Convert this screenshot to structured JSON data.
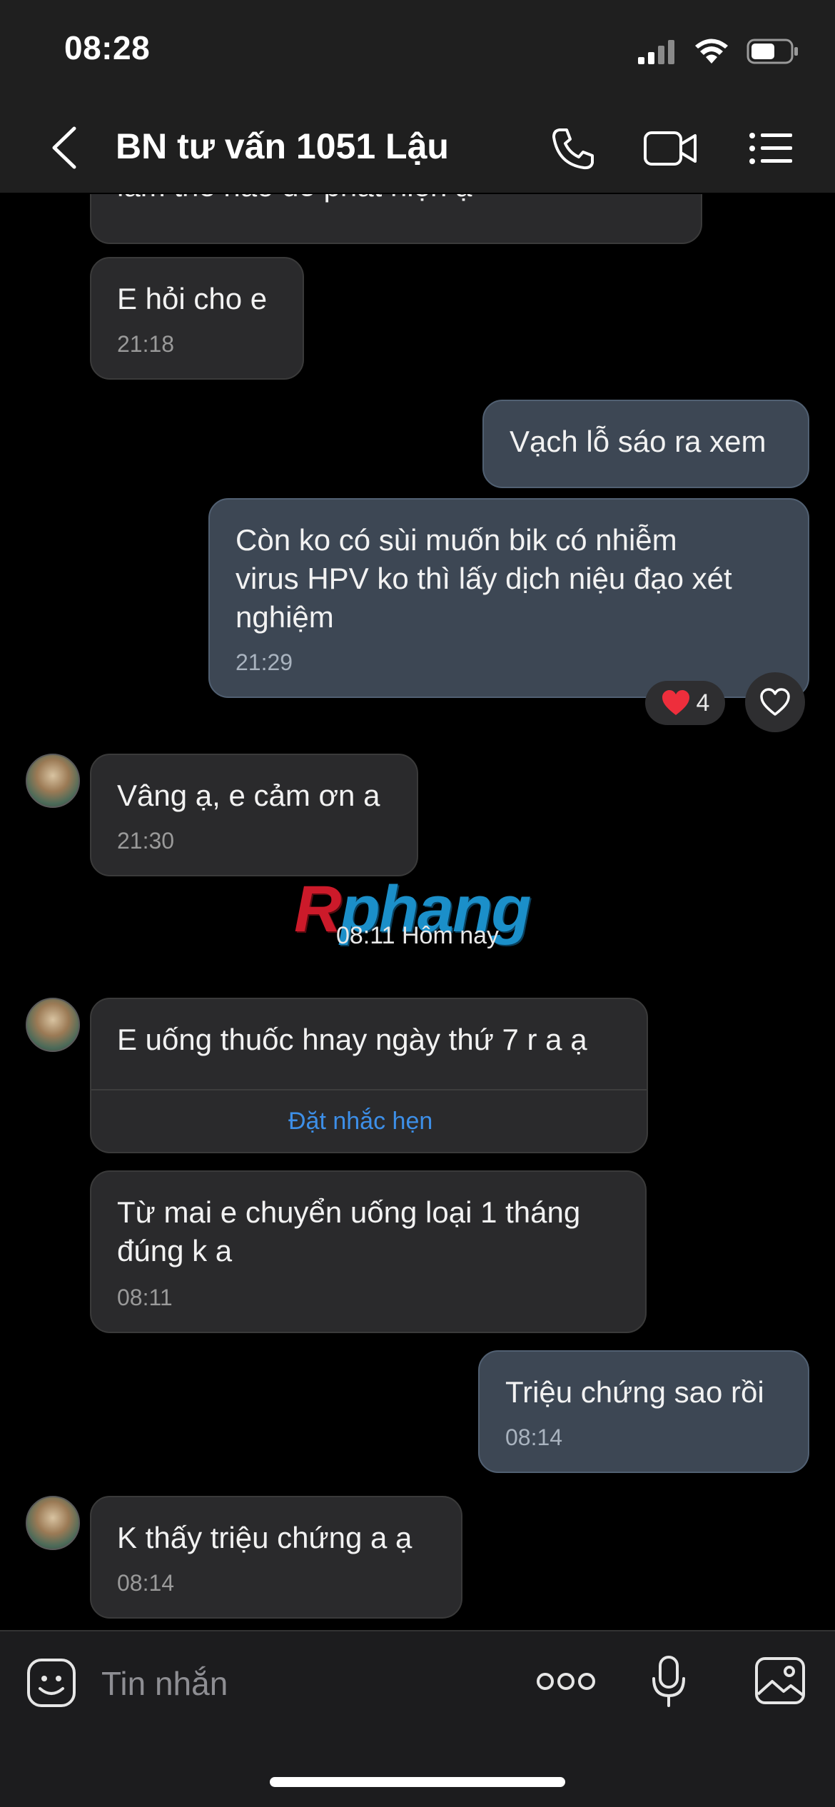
{
  "status_bar": {
    "time": "08:28"
  },
  "header": {
    "title": "BN tư vấn 1051 Lậu"
  },
  "messages": {
    "m0": {
      "text": "làm thế nào để phát hiện ạ"
    },
    "m1": {
      "text": "E hỏi cho e",
      "time": "21:18"
    },
    "m2": {
      "text": "Vạch lỗ sáo ra xem"
    },
    "m3": {
      "line1": "Còn ko có sùi muốn bik có nhiễm",
      "line2": "virus HPV ko thì lấy dịch niệu đạo xét",
      "line3": "nghiệm",
      "time": "21:29",
      "reaction_count": "4"
    },
    "m4": {
      "text": "Vâng ạ, e cảm ơn a",
      "time": "21:30"
    },
    "m5": {
      "text": "E uống thuốc hnay ngày thứ 7 r a ạ",
      "action": "Đặt nhắc hẹn"
    },
    "m6": {
      "line1": "Từ mai e chuyển uống loại 1 tháng",
      "line2": "đúng k a",
      "time": "08:11"
    },
    "m7": {
      "text": "Triệu chứng sao rồi",
      "time": "08:14"
    },
    "m8": {
      "text": "K thấy triệu chứng a ạ",
      "time": "08:14"
    }
  },
  "date_separator": "08:11 Hôm nay",
  "watermark": {
    "first": "R",
    "rest": "phang"
  },
  "input": {
    "placeholder": "Tin nhắn"
  },
  "colors": {
    "outgoing_bubble": "#3d4754",
    "incoming_bubble": "#2a2a2c",
    "link": "#3d8fe8"
  }
}
